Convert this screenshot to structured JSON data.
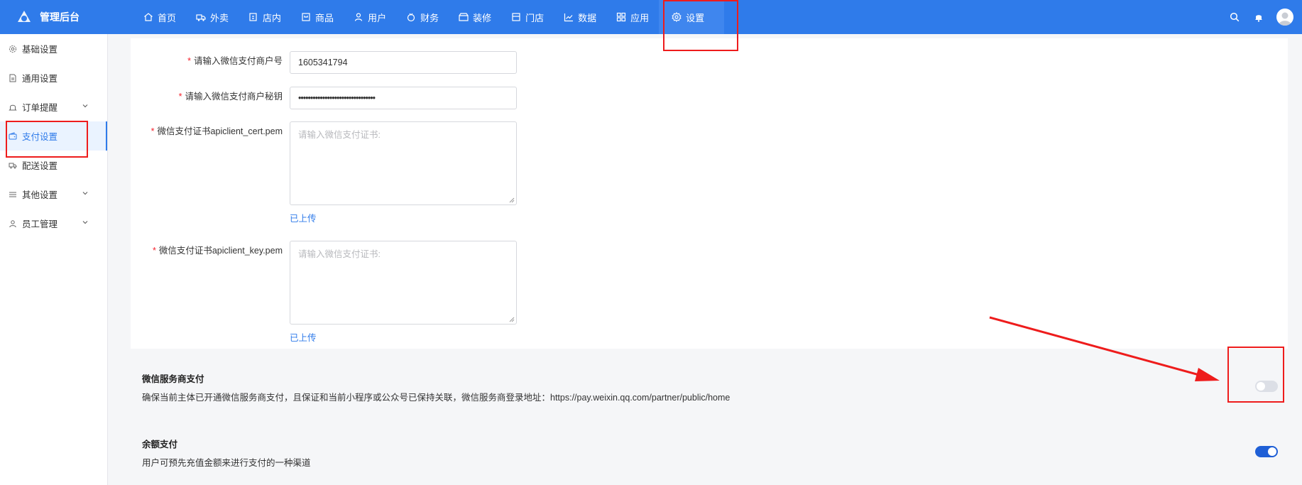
{
  "app": {
    "title": "管理后台"
  },
  "nav": [
    {
      "label": "首页",
      "icon": "home-icon"
    },
    {
      "label": "外卖",
      "icon": "delivery-icon"
    },
    {
      "label": "店内",
      "icon": "store-icon"
    },
    {
      "label": "商品",
      "icon": "goods-icon"
    },
    {
      "label": "用户",
      "icon": "user-icon"
    },
    {
      "label": "财务",
      "icon": "finance-icon"
    },
    {
      "label": "装修",
      "icon": "decorate-icon"
    },
    {
      "label": "门店",
      "icon": "shop-icon"
    },
    {
      "label": "数据",
      "icon": "chart-icon"
    },
    {
      "label": "应用",
      "icon": "apps-icon"
    },
    {
      "label": "设置",
      "icon": "gear-icon",
      "active": true
    }
  ],
  "sidebar": [
    {
      "label": "基础设置",
      "icon": "gear-icon"
    },
    {
      "label": "通用设置",
      "icon": "file-icon"
    },
    {
      "label": "订单提醒",
      "icon": "bell-icon",
      "expandable": true
    },
    {
      "label": "支付设置",
      "icon": "wallet-icon",
      "active": true
    },
    {
      "label": "配送设置",
      "icon": "delivery-icon"
    },
    {
      "label": "其他设置",
      "icon": "list-icon",
      "expandable": true
    },
    {
      "label": "员工管理",
      "icon": "user-icon",
      "expandable": true
    }
  ],
  "form": {
    "merchant_id": {
      "label": "请输入微信支付商户号",
      "value": "1605341794"
    },
    "merchant_secret": {
      "label": "请输入微信支付商户秘钥",
      "value": "••••••••••••••••••••••••••••••••"
    },
    "cert_pem": {
      "label": "微信支付证书apiclient_cert.pem",
      "placeholder": "请输入微信支付证书:",
      "uploaded": "已上传"
    },
    "key_pem": {
      "label": "微信支付证书apiclient_key.pem",
      "placeholder": "请输入微信支付证书:",
      "uploaded": "已上传"
    }
  },
  "cards": [
    {
      "title": "微信服务商支付",
      "desc": "确保当前主体已开通微信服务商支付，且保证和当前小程序或公众号已保持关联，微信服务商登录地址：https://pay.weixin.qq.com/partner/public/home",
      "enabled": false
    },
    {
      "title": "余额支付",
      "desc": "用户可预先充值金额来进行支付的一种渠道",
      "enabled": true
    }
  ],
  "colors": {
    "primary": "#2f7bea",
    "annotation": "#ee1c1c",
    "switch_off": "#dcdfe6"
  }
}
